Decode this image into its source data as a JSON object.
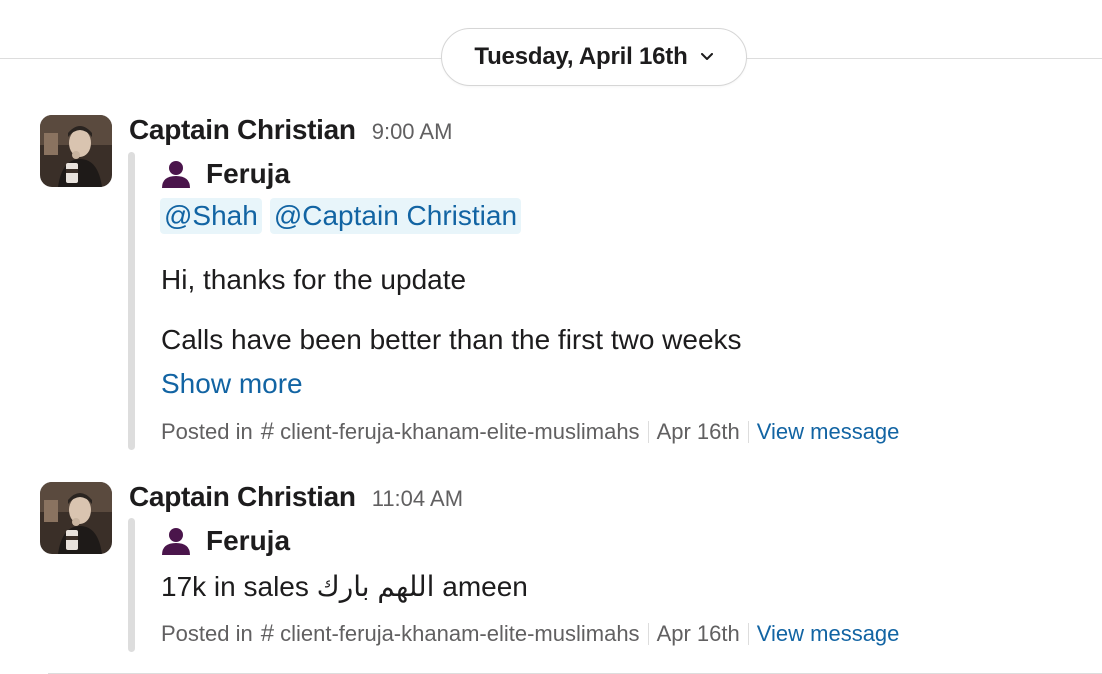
{
  "date_divider": {
    "label": "Tuesday, April 16th",
    "chevron_icon": "chevron-down-icon"
  },
  "messages": [
    {
      "sender": "Captain Christian",
      "time": "9:00 AM",
      "shared": {
        "author": "Feruja",
        "mentions": [
          "@Shah",
          "@Captain Christian"
        ],
        "lines": [
          "Hi, thanks for the update",
          "Calls have been better than the first two weeks"
        ],
        "show_more": "Show more",
        "posted_in": "Posted in",
        "channel": "client-feruja-khanam-elite-muslimahs",
        "date": "Apr 16th",
        "view": "View message"
      }
    },
    {
      "sender": "Captain Christian",
      "time": "11:04 AM",
      "shared": {
        "author": "Feruja",
        "lines": [
          "17k in sales اللهم بارك  ameen"
        ],
        "posted_in": "Posted in",
        "channel": "client-feruja-khanam-elite-muslimahs",
        "date": "Apr 16th",
        "view": "View message"
      }
    }
  ],
  "colors": {
    "link": "#1264a3",
    "mention_bg": "#e8f5fa",
    "avatar_person": "#4a154b",
    "quote_bar": "#dddddd"
  }
}
